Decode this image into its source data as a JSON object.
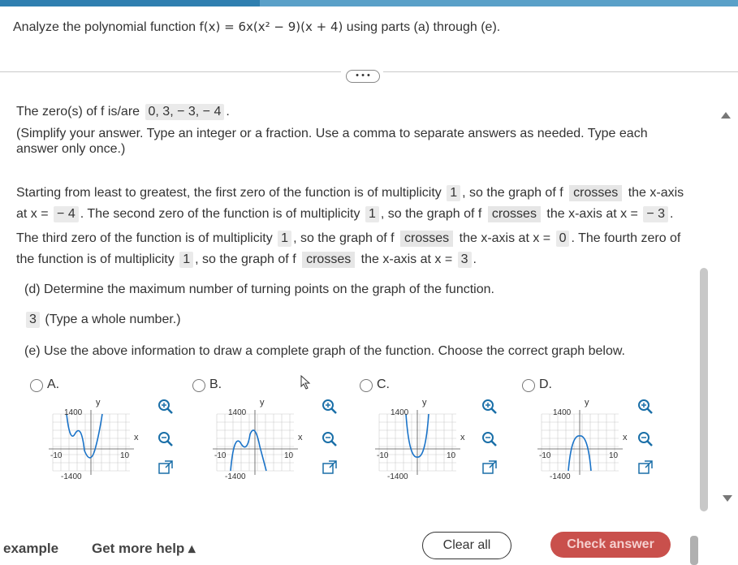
{
  "question": {
    "prefix": "Analyze the polynomial function",
    "function": "f(x) = 6x(x² − 9)(x + 4)",
    "suffix": "using parts (a) through (e)."
  },
  "more_button": "• • •",
  "zeros": {
    "label": "The zero(s) of f is/are",
    "answer": "0, 3, − 3, − 4",
    "period": ".",
    "hint1": "(Simplify your answer. Type an integer or a fraction. Use a comma to separate answers as needed. Type each",
    "hint2": "answer only once.)"
  },
  "multiplicity": {
    "l1a": "Starting from least to greatest, the first zero of the function is of multiplicity",
    "m1": "1",
    "l1b": ", so the graph of f",
    "c1": "crosses",
    "l1c": "the x-axis",
    "l2a": "at x =",
    "x1": "− 4",
    "l2b": ". The second zero of the function is of multiplicity",
    "m2": "1",
    "l2c": ", so the graph of f",
    "c2": "crosses",
    "l2d": "the x-axis at x =",
    "x2": "− 3",
    "l2e": ".",
    "l3a": "The third zero of the function is of multiplicity",
    "m3": "1",
    "l3b": ", so the graph of f",
    "c3": "crosses",
    "l3c": "the x-axis at x =",
    "x3": "0",
    "l3d": ". The fourth zero of",
    "l4a": "the function is of multiplicity",
    "m4": "1",
    "l4b": ", so the graph of f",
    "c4": "crosses",
    "l4c": "the x-axis at x =",
    "x4": "3",
    "l4d": "."
  },
  "part_d": {
    "label": "(d) Determine the maximum number of turning points on the graph of the function.",
    "answer": "3",
    "hint": "(Type a whole number.)"
  },
  "part_e": {
    "label": "(e) Use the above information to draw a complete graph of the function. Choose the correct graph below."
  },
  "options": [
    {
      "letter": "A.",
      "ymax": "1400",
      "ymin": "-1400",
      "xmin": "-10",
      "xmax": "10",
      "xlabel": "x",
      "ylabel": "y"
    },
    {
      "letter": "B.",
      "ymax": "1400",
      "ymin": "-1400",
      "xmin": "-10",
      "xmax": "10",
      "xlabel": "x",
      "ylabel": "y"
    },
    {
      "letter": "C.",
      "ymax": "1400",
      "ymin": "-1400",
      "xmin": "-10",
      "xmax": "10",
      "xlabel": "x",
      "ylabel": "y"
    },
    {
      "letter": "D.",
      "ymax": "1400",
      "ymin": "-1400",
      "xmin": "-10",
      "xmax": "10",
      "xlabel": "x",
      "ylabel": "y"
    }
  ],
  "footer": {
    "example": "example",
    "get_more_help": "Get more help ▴",
    "clear_all": "Clear all",
    "check_answer": "Check answer"
  },
  "colors": {
    "accent": "#2f7fb0",
    "check": "#c9504c",
    "answer_bg": "#eaeaea"
  }
}
